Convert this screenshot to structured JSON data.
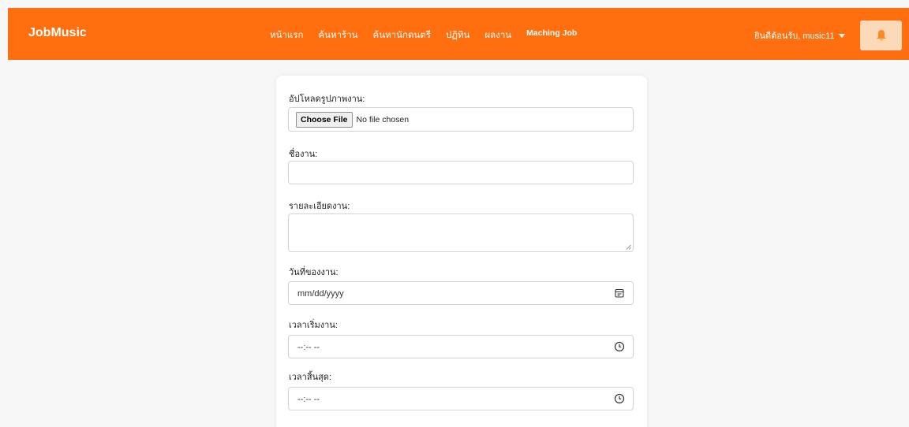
{
  "brand": "JobMusic",
  "nav": {
    "items": [
      "หน้าแรก",
      "ค้นหาร้าน",
      "ค้นหานักดนตรี",
      "ปฏิทิน",
      "ผลงาน",
      "Maching Job"
    ]
  },
  "user_menu": {
    "label": "ยินดีต้อนรับ, music11"
  },
  "colors": {
    "navbar": "#ff6f0f",
    "bell_button": "#fcd9b8",
    "bell_icon": "#ff8a1e"
  },
  "form": {
    "upload_label": "อัปโหลดรูปภาพงาน:",
    "choose_file_label": "Choose File",
    "no_file_text": "No file chosen",
    "job_name_label": "ชื่องาน:",
    "job_name_value": "",
    "job_desc_label": "รายละเอียดงาน:",
    "job_desc_value": "",
    "date_label": "วันที่ของงาน:",
    "date_placeholder": "mm/dd/yyyy",
    "start_time_label": "เวลาเริ่มงาน:",
    "start_time_placeholder": "--:-- --",
    "end_time_label": "เวลาสิ้นสุด:",
    "end_time_placeholder": "--:-- --"
  }
}
